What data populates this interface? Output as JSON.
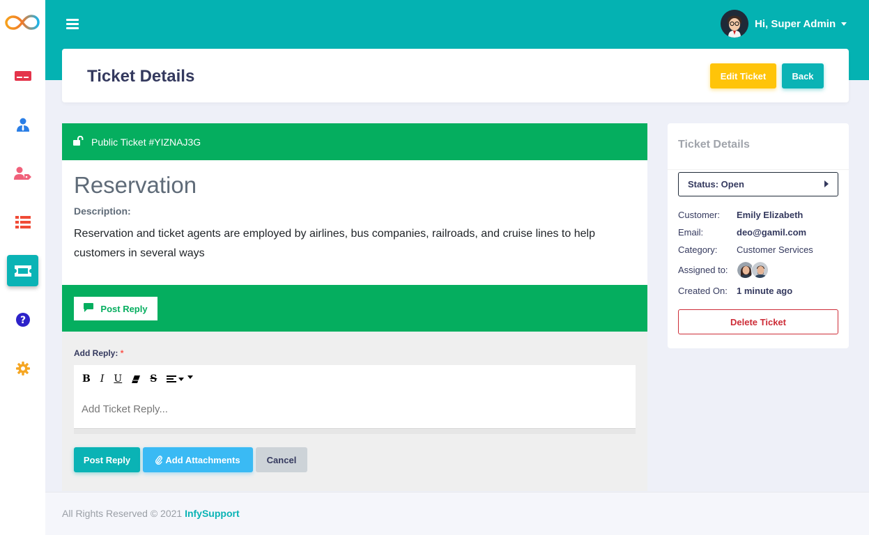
{
  "header": {
    "user_greeting": "Hi, Super Admin"
  },
  "sidebar": {
    "items": [
      {
        "icon": "credit-card-icon",
        "color": "#e4344b"
      },
      {
        "icon": "user-tie-icon",
        "color": "#2a7ee6"
      },
      {
        "icon": "user-tag-icon",
        "color": "#f0607a"
      },
      {
        "icon": "list-icon",
        "color": "#f04b36"
      },
      {
        "icon": "ticket-icon",
        "color": "#ffffff",
        "active": true
      },
      {
        "icon": "question-circle-icon",
        "color": "#2d22c9"
      },
      {
        "icon": "gear-icon",
        "color": "#f5a623"
      }
    ]
  },
  "page": {
    "title": "Ticket Details",
    "edit_label": "Edit Ticket",
    "back_label": "Back"
  },
  "ticket": {
    "header_label": "Public Ticket #YIZNAJ3G",
    "title": "Reservation",
    "description_label": "Description:",
    "description": "Reservation and ticket agents are employed by airlines, bus companies, railroads, and cruise lines to help customers in several ways",
    "reply_tab_label": "Post Reply",
    "add_reply_label": "Add Reply:",
    "required_mark": "*",
    "reply_placeholder": "Add Ticket Reply...",
    "post_reply_button": "Post Reply",
    "add_attachments_button": "Add Attachments",
    "cancel_button": "Cancel"
  },
  "details": {
    "title": "Ticket Details",
    "status_label": "Status: Open",
    "customer_key": "Customer:",
    "customer_value": "Emily Elizabeth",
    "email_key": "Email:",
    "email_value": "deo@gamil.com",
    "category_key": "Category:",
    "category_value": "Customer Services",
    "assigned_key": "Assigned to:",
    "created_key": "Created On:",
    "created_value": "1 minute ago",
    "delete_label": "Delete Ticket"
  },
  "footer": {
    "text": "All Rights Reserved © 2021",
    "link": "InfySupport"
  },
  "colors": {
    "primary": "#04b2b2",
    "success": "#05ae5f",
    "warning": "#ffc409",
    "info": "#3abaf4",
    "danger": "#cd2c37"
  }
}
